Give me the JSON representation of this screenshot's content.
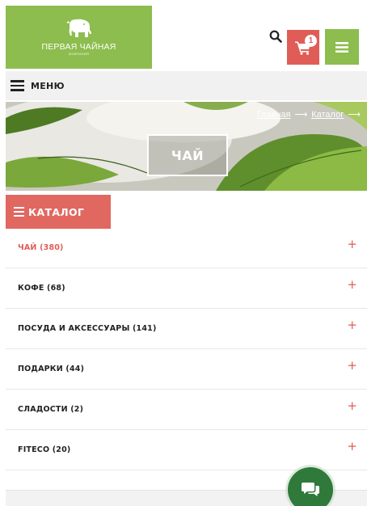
{
  "brand": {
    "name": "ПЕРВАЯ ЧАЙНАЯ",
    "subtitle": "КОМПАНИЯ",
    "color": "#8cbd4e"
  },
  "header": {
    "search_icon": "search-icon",
    "cart_icon": "cart-icon",
    "cart_count": "1",
    "menu_icon": "hamburger-icon",
    "accent_red": "#e05d57"
  },
  "menu_bar": {
    "label": "МЕНЮ"
  },
  "hero": {
    "title": "ЧАЙ",
    "breadcrumb": {
      "home": "Главная",
      "separator": "⟶",
      "catalog": "Каталог"
    }
  },
  "catalog": {
    "button_label": "КАТАЛОГ",
    "items": [
      {
        "label": "ЧАЙ (380)",
        "active": true
      },
      {
        "label": "КОФЕ (68)",
        "active": false
      },
      {
        "label": "ПОСУДА И АКСЕССУАРЫ (141)",
        "active": false
      },
      {
        "label": "ПОДАРКИ (44)",
        "active": false
      },
      {
        "label": "СЛАДОСТИ (2)",
        "active": false
      },
      {
        "label": "FITECO (20)",
        "active": false
      }
    ],
    "expand_symbol": "+"
  },
  "chat": {
    "icon": "chat-icon",
    "color": "#2f7a3a"
  }
}
